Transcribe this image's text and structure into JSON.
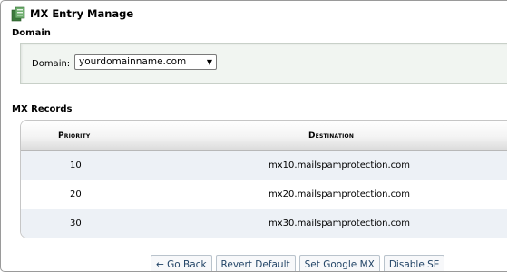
{
  "page": {
    "title": "MX Entry Manage"
  },
  "domain_section": {
    "heading": "Domain",
    "label": "Domain:",
    "selected": "yourdomainname.com"
  },
  "mx_section": {
    "heading": "MX Records",
    "columns": {
      "priority": "Priority",
      "destination": "Destination"
    },
    "rows": [
      {
        "priority": "10",
        "destination": "mx10.mailspamprotection.com"
      },
      {
        "priority": "20",
        "destination": "mx20.mailspamprotection.com"
      },
      {
        "priority": "30",
        "destination": "mx30.mailspamprotection.com"
      }
    ]
  },
  "buttons": {
    "go_back": "← Go Back",
    "revert_default": "Revert Default",
    "set_google_mx": "Set Google MX",
    "disable_se": "Disable SE"
  }
}
